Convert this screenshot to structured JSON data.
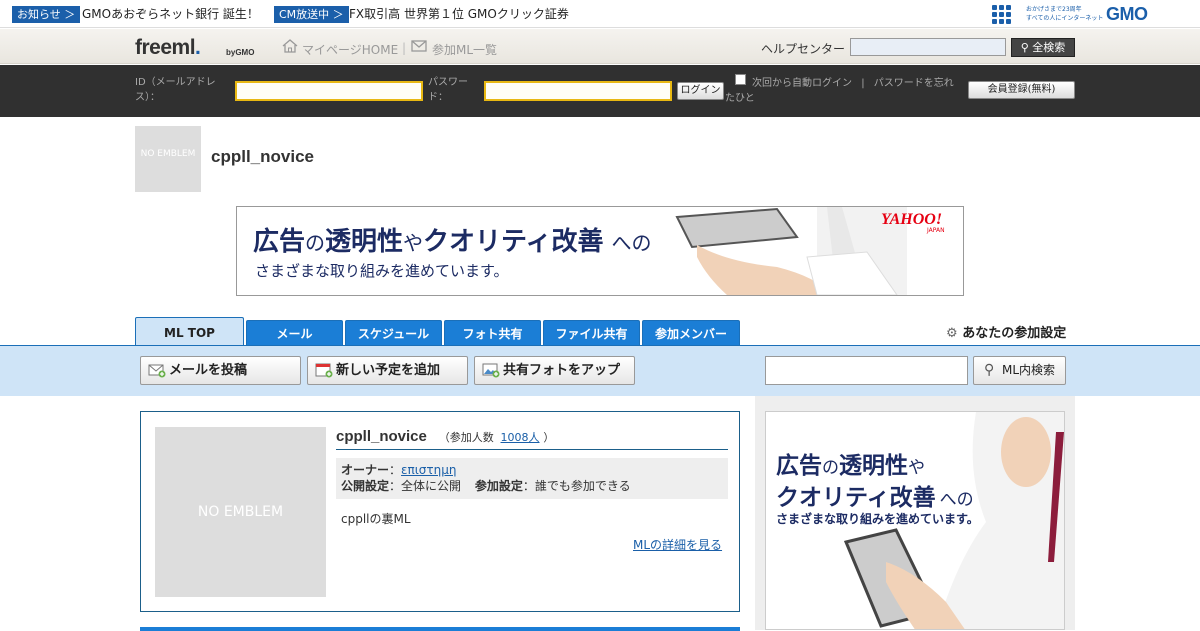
{
  "news": [
    {
      "badge": "お知らせ ＞",
      "text": "GMOあおぞらネット銀行 誕生！"
    },
    {
      "badge": "CM放送中 ＞",
      "text": "FX取引高 世界第１位 GMOクリック証券"
    }
  ],
  "gmo": {
    "tagline": "おかげさまで23周年\nすべての人にインターネット",
    "logo": "GMO"
  },
  "header": {
    "logo": "freeml",
    "logo_dot": ".",
    "logo_sub": "byGMO",
    "mypage": "マイページHOME",
    "separator": "|",
    "joined_ml": "参加ML一覧",
    "help_label": "ヘルプセンター",
    "search_button": "全検索"
  },
  "login": {
    "id_label": "ID（メールアドレス）：",
    "password_label": "パスワード：",
    "login_button": "ログイン",
    "auto_login": "次回から自動ログイン",
    "separator": "|",
    "forgot": "パスワードを忘れたひと",
    "register_button": "会員登録(無料)"
  },
  "ml": {
    "emblem_small": "NO EMBLEM",
    "name": "cppll_novice",
    "emblem_large": "NO EMBLEM",
    "members_label": "（参加人数",
    "members": "1008人",
    "members_close": "）",
    "owner_label": "オーナー",
    "owner": "επιστημη",
    "public_label": "公開設定",
    "public_value": "全体に公開",
    "join_label": "参加設定",
    "join_value": "誰でも参加できる",
    "description": "cppllの裏ML",
    "detail_link": "MLの詳細を見る"
  },
  "ad_top": {
    "line1_a": "広告",
    "line1_b": "の",
    "line1_c": "透明性",
    "line1_d": "や",
    "line1_e": "クオリティ改善",
    "line1_f": "への",
    "line2": "さまざまな取り組みを進めています。",
    "brand": "YAHOO!",
    "brand_sub": "JAPAN"
  },
  "ad_side": {
    "line1_a": "広告",
    "line1_b": "の",
    "line1_c": "透明性",
    "line1_d": "や",
    "line2_a": "クオリティ改善",
    "line2_b": "への",
    "line3": "さまざまな取り組みを進めています。"
  },
  "tabs": [
    {
      "label": "ML TOP"
    },
    {
      "label": "メール"
    },
    {
      "label": "スケジュール"
    },
    {
      "label": "フォト共有"
    },
    {
      "label": "ファイル共有"
    },
    {
      "label": "参加メンバー"
    }
  ],
  "settings": "あなたの参加設定",
  "actions": {
    "post_mail": "メールを投稿",
    "add_event": "新しい予定を追加",
    "add_photo": "共有フォトをアップ",
    "ml_search": "ML内検索"
  },
  "colors": {
    "brand_blue": "#1b5faa",
    "tab_blue": "#1b7ed6",
    "light_blue": "#cfe4f7",
    "login_bg": "#303030",
    "input_border": "#e8b812"
  }
}
